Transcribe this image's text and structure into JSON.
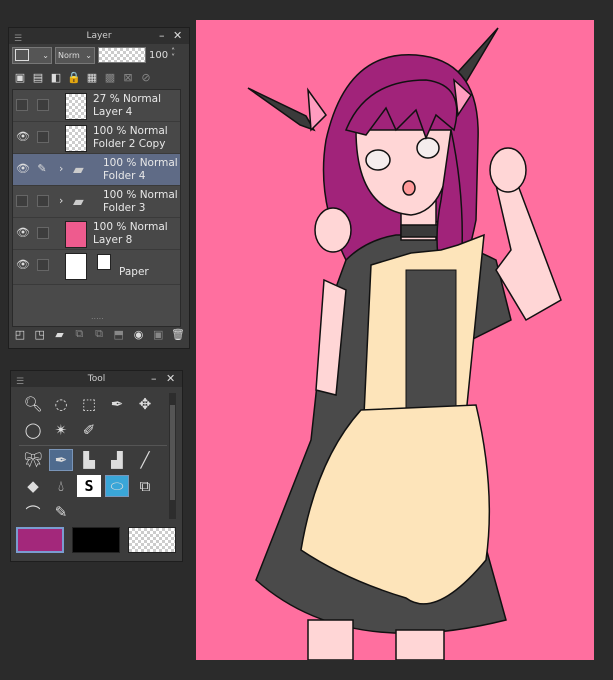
{
  "layer_panel": {
    "title": "Layer",
    "blend_mode": "Norm",
    "opacity_value": "100",
    "layers": [
      {
        "line1": "27 % Normal",
        "line2": "Layer 4"
      },
      {
        "line1": "100 % Normal",
        "line2": "Folder 2 Copy"
      },
      {
        "line1": "100 % Normal",
        "line2": "Folder 4"
      },
      {
        "line1": "100 % Normal",
        "line2": "Folder 3"
      },
      {
        "line1": "100 % Normal",
        "line2": "Layer 8"
      },
      {
        "line1": "",
        "line2": "Paper"
      }
    ],
    "layer8_color": "#ee5b8e",
    "dots": "....."
  },
  "tool_panel": {
    "title": "Tool",
    "tools": [
      "zoom-icon",
      "rotate-icon",
      "move-layer-icon",
      "pen-select-icon",
      "move-icon",
      "lasso-icon",
      "magic-wand-icon",
      "eyedropper-icon",
      "ribbon-icon",
      "pen-icon",
      "pencil-icon",
      "brush-icon",
      "line-icon",
      "eraser-icon",
      "fill-icon",
      "text-icon",
      "vector-icon",
      "frame-icon",
      "curve-icon",
      "correct-line-icon"
    ],
    "text_tool_glyph": "S",
    "main_color": "#a3287b",
    "sub_color": "#000000"
  },
  "canvas": {
    "background": "#ff6f9f"
  }
}
